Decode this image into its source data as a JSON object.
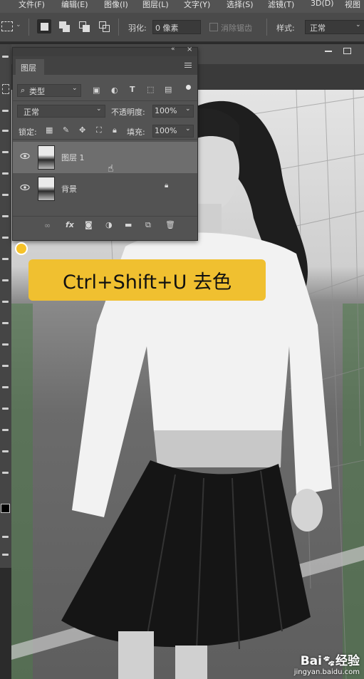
{
  "menu": {
    "items": [
      "文件(F)",
      "编辑(E)",
      "图像(I)",
      "图层(L)",
      "文字(Y)",
      "选择(S)",
      "滤镜(T)",
      "3D(D)",
      "视图"
    ]
  },
  "options": {
    "feather_label": "羽化:",
    "feather_value": "0 像素",
    "antialias_label": "消除锯齿",
    "style_label": "样式:",
    "style_value": "正常"
  },
  "layers_panel": {
    "title": "图层",
    "filter_kind": "类型",
    "blend_mode": "正常",
    "opacity_label": "不透明度:",
    "opacity_value": "100%",
    "lock_label": "锁定:",
    "fill_label": "填充:",
    "fill_value": "100%",
    "layers": [
      {
        "name": "图层 1",
        "selected": true
      },
      {
        "name": "背景",
        "locked": true
      }
    ],
    "footer_fx": "fx"
  },
  "tooltip": {
    "text": "Ctrl+Shift+U 去色"
  },
  "watermark": {
    "brand": "Bai",
    "brand_cn": "经验",
    "url": "jingyan.baidu.com"
  },
  "colors": {
    "accent_yellow": "#f0c030",
    "panel_bg": "#535353",
    "selected_row": "#6e6e6e"
  }
}
